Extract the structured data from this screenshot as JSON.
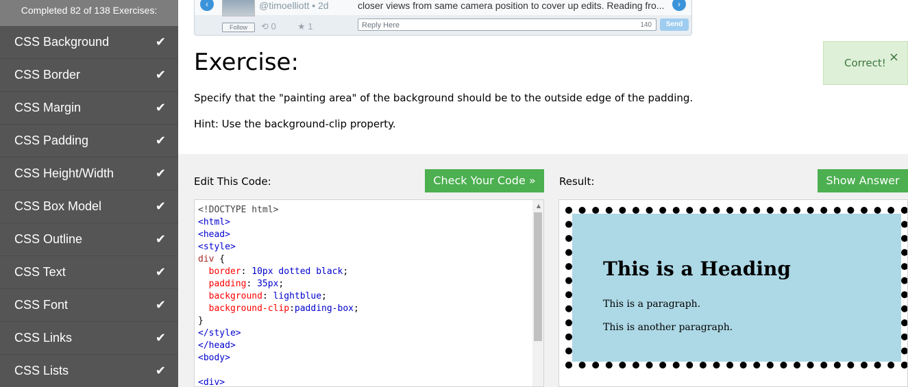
{
  "sidebar": {
    "progress": "Completed 82 of 138 Exercises:",
    "items": [
      {
        "label": "CSS Background"
      },
      {
        "label": "CSS Border"
      },
      {
        "label": "CSS Margin"
      },
      {
        "label": "CSS Padding"
      },
      {
        "label": "CSS Height/Width"
      },
      {
        "label": "CSS Box Model"
      },
      {
        "label": "CSS Outline"
      },
      {
        "label": "CSS Text"
      },
      {
        "label": "CSS Font"
      },
      {
        "label": "CSS Links"
      },
      {
        "label": "CSS Lists"
      }
    ],
    "check_glyph": "✔"
  },
  "tweet": {
    "handle": "@timoelliott • 2d",
    "text": "closer views from same camera position to cover up edits. Reading fro...",
    "follow_label": "Follow",
    "retweets": "0",
    "favorites": "1",
    "reply_placeholder": "Reply Here",
    "char_count": "140",
    "send_label": "Send"
  },
  "exercise": {
    "title": "Exercise:",
    "description": "Specify that the \"painting area\" of the background should be to the outside edge of the padding.",
    "hint": "Hint: Use the background-clip property."
  },
  "alert": {
    "text": "Correct!",
    "close": "×"
  },
  "editor": {
    "label": "Edit This Code:",
    "check_button": "Check Your Code »"
  },
  "result": {
    "label": "Result:",
    "answer_button": "Show Answer",
    "heading": "This is a Heading",
    "para1": "This is a paragraph.",
    "para2": "This is another paragraph."
  },
  "colors": {
    "accent_green": "#4caf50",
    "sidebar_bg": "#555555",
    "alert_bg": "#dff0d8",
    "result_bg": "#add8e6"
  }
}
